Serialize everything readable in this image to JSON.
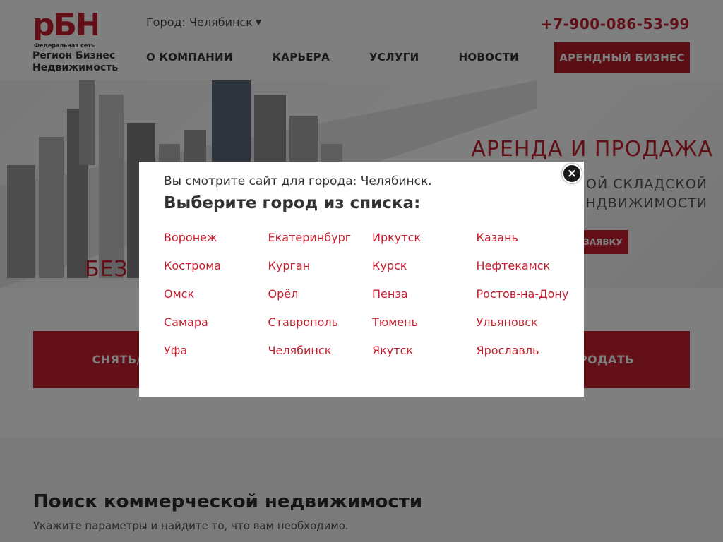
{
  "header": {
    "logo_text": "рБН",
    "logo_tagline": "Федеральная сеть",
    "logo_name_line1": "Регион Бизнес",
    "logo_name_line2": "Недвижимость",
    "city_selector": "Город: Челябинск",
    "phone": "+7-900-086-53-99",
    "nav": [
      "О КОМПАНИИ",
      "КАРЬЕРА",
      "УСЛУГИ",
      "НОВОСТИ"
    ],
    "cta": "АРЕНДНЫЙ БИЗНЕС"
  },
  "hero": {
    "title": "АРЕНДА И ПРОДАЖА",
    "subtitle": "ОЙ СКЛАДСКОЙ НДВИЖИМОСТИ",
    "button": "ЗАЯВКУ",
    "left_text": "БЕЗ"
  },
  "actions": {
    "left": "СНЯТЬ/К",
    "right": "ПРОДАТЬ"
  },
  "search": {
    "title": "Поиск коммерческой недвижимости",
    "subtitle": "Укажите параметры и найдите то, что вам необходимо."
  },
  "modal": {
    "current_city_text": "Вы смотрите сайт для города: Челябинск.",
    "title": "Выберите город из списка:",
    "close_label": "×",
    "cities": [
      "Воронеж",
      "Екатеринбург",
      "Иркутск",
      "Казань",
      "Кострома",
      "Курган",
      "Курск",
      "Нефтекамск",
      "Омск",
      "Орёл",
      "Пенза",
      "Ростов-на-Дону",
      "Самара",
      "Ставрополь",
      "Тюмень",
      "Ульяновск",
      "Уфа",
      "Челябинск",
      "Якутск",
      "Ярославль"
    ]
  },
  "colors": {
    "brand_red": "#c41e2f",
    "dark_red": "#b61c26",
    "overlay": "rgba(0,0,0,0.5)"
  }
}
